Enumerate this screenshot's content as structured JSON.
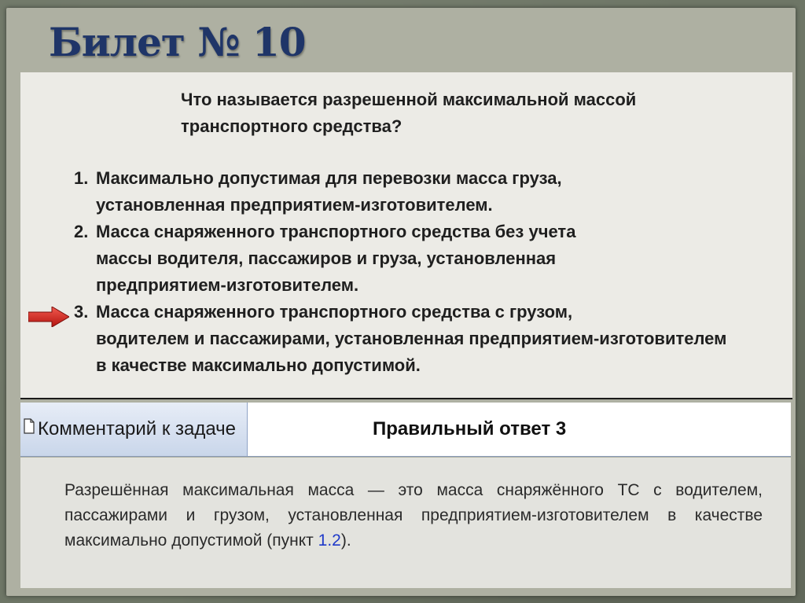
{
  "slide": {
    "title": "Билет № 10"
  },
  "question": {
    "line1": "Что называется разрешенной максимальной массой",
    "line2": "транспортного средства?"
  },
  "answers": [
    {
      "num": "1.",
      "lines": [
        "Максимально допустимая для перевозки масса груза,",
        "установленная предприятием-изготовителем."
      ]
    },
    {
      "num": "2.",
      "lines": [
        "Масса снаряженного транспортного средства без учета",
        "массы водителя, пассажиров и груза, установленная",
        "предприятием-изготовителем."
      ]
    },
    {
      "num": "3.",
      "lines": [
        "Масса снаряженного транспортного средства с грузом,",
        "водителем и пассажирами, установленная предприятием-изготовителем",
        "в качестве максимально допустимой."
      ]
    }
  ],
  "comment_bar": {
    "tab_label": "Комментарий к задаче",
    "correct_answer": "Правильный ответ  3"
  },
  "explanation": {
    "text": "Разрешённая максимальная масса — это масса снаряжённого ТС с водителем, пассажирами и грузом, установленная предприятием-изготовителем в качестве максимально допустимой (пункт ",
    "link": "1.2",
    "tail": ")."
  },
  "icons": {
    "selected_answer": "arrow-right-icon",
    "comment_tab": "document-icon"
  },
  "colors": {
    "title": "#1f3568",
    "arrow": "#d8231d",
    "link": "#1e39c9"
  }
}
